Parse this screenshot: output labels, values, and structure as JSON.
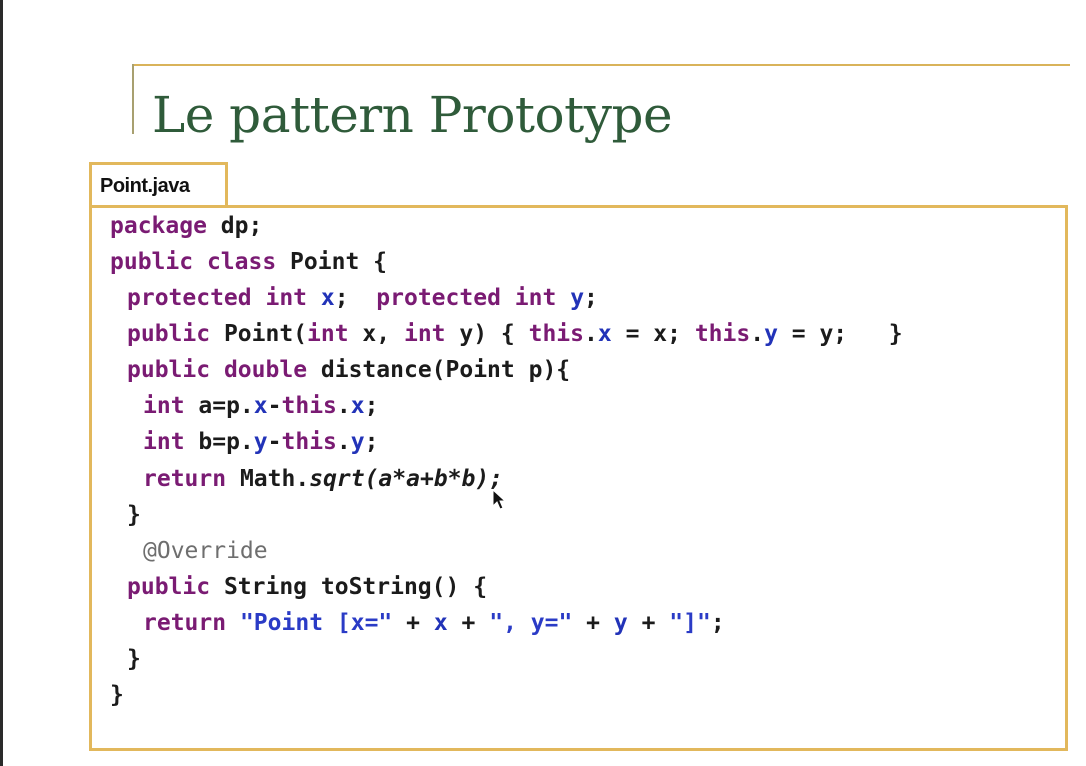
{
  "slide": {
    "title": "Le pattern Prototype",
    "tab_label": "Point.java"
  },
  "code": {
    "l1_kw": "package",
    "l1_rest": " dp;",
    "l2_kw1": "public",
    "l2_kw2": "class",
    "l2_rest": " Point {",
    "l3_kw1": "protected",
    "l3_kw2": "int",
    "l3_f1": "x",
    "l3_sep": ";  ",
    "l3_kw3": "protected",
    "l3_kw4": "int",
    "l3_f2": "y",
    "l3_end": ";",
    "l4_kw1": "public",
    "l4_a": " Point(",
    "l4_kw2": "int",
    "l4_b": " x, ",
    "l4_kw3": "int",
    "l4_c": " y) { ",
    "l4_kw4": "this",
    "l4_dot1": ".",
    "l4_f1": "x",
    "l4_d": " = x; ",
    "l4_kw5": "this",
    "l4_dot2": ".",
    "l4_f2": "y",
    "l4_e": " = y;   }",
    "l5_kw1": "public",
    "l5_kw2": "double",
    "l5_rest": " distance(Point p){",
    "l6_kw": "int",
    "l6_a": " a=p.",
    "l6_f1": "x",
    "l6_b": "-",
    "l6_kw2": "this",
    "l6_c": ".",
    "l6_f2": "x",
    "l6_d": ";",
    "l7_kw": "int",
    "l7_a": " b=p.",
    "l7_f1": "y",
    "l7_b": "-",
    "l7_kw2": "this",
    "l7_c": ".",
    "l7_f2": "y",
    "l7_d": ";",
    "l8_kw": "return",
    "l8_a": " Math.",
    "l8_it": "sqrt(a*a+b*b);",
    "l9": "}",
    "l10": "@Override",
    "l11_kw": "public",
    "l11_rest": " String toString() {",
    "l12_kw": "return",
    "l12_s1": "\"Point [x=\"",
    "l12_a": " + ",
    "l12_f1": "x",
    "l12_b": " + ",
    "l12_s2": "\", y=\"",
    "l12_c": " + ",
    "l12_f2": "y",
    "l12_d": " + ",
    "l12_s3": "\"]\"",
    "l12_e": ";",
    "l13": "}",
    "l14": "}"
  },
  "icons": {
    "cursor": "mouse-pointer-icon"
  },
  "colors": {
    "title": "#2f5b3a",
    "border": "#e2b85c",
    "keyword": "#7a1b73",
    "field": "#2233b8",
    "string": "#2a3bc6",
    "annotation": "#6e6e6e"
  }
}
